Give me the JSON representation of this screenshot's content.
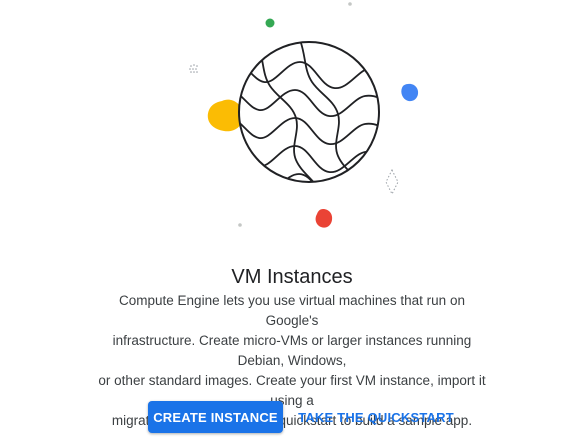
{
  "empty_state": {
    "title": "VM Instances",
    "description_lines": [
      "Compute Engine lets you use virtual machines that run on Google's",
      "infrastructure. Create micro-VMs or larger instances running Debian, Windows,",
      "or other standard images. Create your first VM instance, import it using a",
      "migration service, or try the quickstart to build a sample app."
    ]
  },
  "actions": {
    "create_label": "CREATE INSTANCE",
    "quickstart_label": "TAKE THE QUICKSTART"
  },
  "colors": {
    "primary": "#1a73e8",
    "yellow": "#fbbc04",
    "blue": "#4285f4",
    "green": "#34a853",
    "red": "#ea4335"
  },
  "illustration": {
    "icon": "globe-waves-icon"
  }
}
